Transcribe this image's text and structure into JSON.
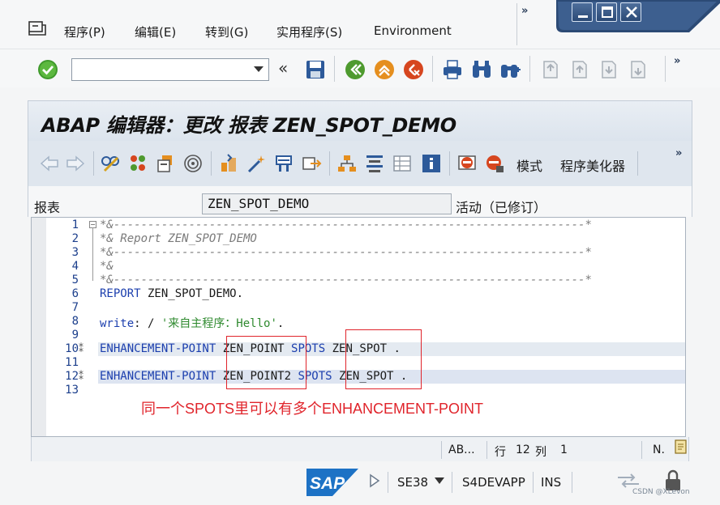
{
  "menubar": {
    "items": [
      {
        "label": "程序(P)"
      },
      {
        "label": "编辑(E)"
      },
      {
        "label": "转到(G)"
      },
      {
        "label": "实用程序(S)"
      },
      {
        "label": "Environment"
      }
    ],
    "more": "»"
  },
  "toolbar": {
    "command_field": {
      "value": "",
      "placeholder": ""
    },
    "collapse": "«",
    "more": "»"
  },
  "title": "ABAP 编辑器：更改 报表 ZEN_SPOT_DEMO",
  "app_toolbar": {
    "mode_label": "模式",
    "pretty_printer_label": "程序美化器",
    "more": "»"
  },
  "report": {
    "label": "报表",
    "value": "ZEN_SPOT_DEMO",
    "status": "活动（已修订）"
  },
  "editor": {
    "lines": [
      {
        "num": "1",
        "text": "*&---------------------------------------------------------------------*"
      },
      {
        "num": "2",
        "text": "*& Report ZEN_SPOT_DEMO"
      },
      {
        "num": "3",
        "text": "*&---------------------------------------------------------------------*"
      },
      {
        "num": "4",
        "text": "*&"
      },
      {
        "num": "5",
        "text": "*&---------------------------------------------------------------------*"
      },
      {
        "num": "6",
        "kw": "REPORT",
        "rest": " ZEN_SPOT_DEMO."
      },
      {
        "num": "7",
        "text": ""
      },
      {
        "num": "8",
        "kw": "write",
        "mid": ": / ",
        "str": "'来自主程序：Hello'",
        "end": "."
      },
      {
        "num": "9",
        "text": ""
      },
      {
        "num": "10",
        "kw": "ENHANCEMENT-POINT",
        "p1": " ZEN_POINT ",
        "kw2": "SPOTS",
        "p2": " ZEN_SPOT ."
      },
      {
        "num": "11",
        "text": ""
      },
      {
        "num": "12",
        "kw": "ENHANCEMENT-POINT",
        "p1": " ZEN_POINT2 ",
        "kw2": "SPOTS",
        "p2": " ZEN_SPOT ."
      },
      {
        "num": "13",
        "text": ""
      }
    ],
    "annotation": "同一个SPOTS里可以有多个ENHANCEMENT-POINT"
  },
  "editor_status": {
    "mode": "AB...",
    "row_label": "行",
    "row": "12",
    "col_label": "列",
    "col": "1",
    "caps": "N."
  },
  "system_status": {
    "transaction": "SE38",
    "server": "S4DEVAPP",
    "input_mode": "INS",
    "watermark": "CSDN @XLevon"
  },
  "colors": {
    "keyword": "#1c3fae",
    "comment": "#7a7a7a",
    "string": "#2f8a2f",
    "annotation_red": "#e0242b",
    "title_bg": "#dce4ed"
  }
}
